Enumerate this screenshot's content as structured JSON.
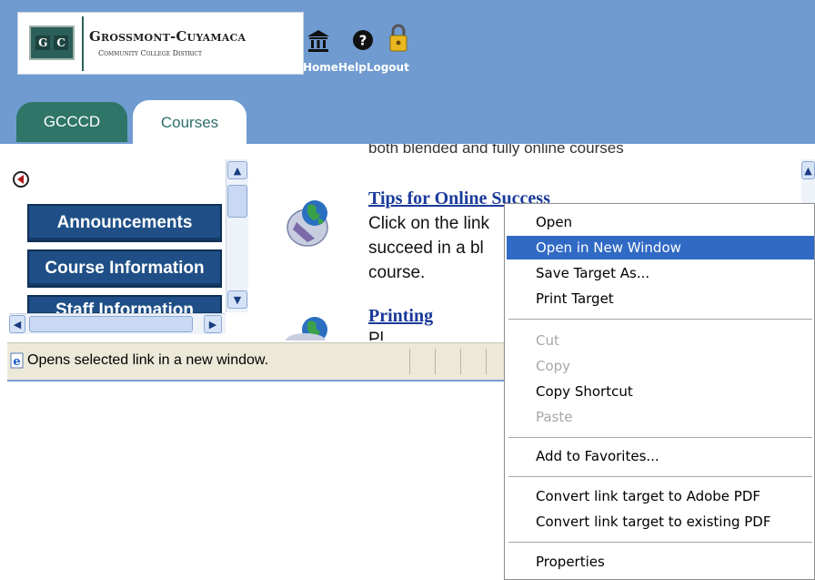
{
  "header": {
    "logo": {
      "mark": [
        "G",
        "C"
      ],
      "title": "Grossmont-Cuyamaca",
      "subtitle": "Community College District"
    },
    "nav": {
      "home": "Home",
      "help": "Help",
      "logout": "Logout"
    }
  },
  "tabs": [
    {
      "label": "GCCCD"
    },
    {
      "label": "Courses"
    }
  ],
  "sidebar": {
    "items": [
      {
        "label": "Announcements"
      },
      {
        "label": "Course Information"
      },
      {
        "label": "Staff Information"
      }
    ]
  },
  "main": {
    "cut_line": "both blended and fully online courses",
    "sections": [
      {
        "title": "Tips for Online Success",
        "lines": [
          "Click on the link",
          "succeed in a bl",
          "course."
        ]
      },
      {
        "title": "Printing",
        "lines": [
          "Pl"
        ]
      }
    ]
  },
  "status": {
    "text": "Opens selected link in a new window."
  },
  "context_menu": {
    "items": [
      {
        "label": "Open",
        "state": "normal"
      },
      {
        "label": "Open in New Window",
        "state": "highlighted"
      },
      {
        "label": "Save Target As...",
        "state": "normal"
      },
      {
        "label": "Print Target",
        "state": "normal"
      },
      {
        "label": "Cut",
        "state": "disabled"
      },
      {
        "label": "Copy",
        "state": "disabled"
      },
      {
        "label": "Copy Shortcut",
        "state": "normal"
      },
      {
        "label": "Paste",
        "state": "disabled"
      },
      {
        "label": "Add to Favorites...",
        "state": "normal"
      },
      {
        "label": "Convert link target to Adobe PDF",
        "state": "normal"
      },
      {
        "label": "Convert link target to existing PDF",
        "state": "normal"
      },
      {
        "label": "Properties",
        "state": "normal"
      }
    ]
  },
  "colors": {
    "header": "#6f9bd0",
    "tab_active_text": "#2f6f6a",
    "menu_button": "#1f4f86",
    "highlight": "#316ac5",
    "link": "#1a3a9a"
  }
}
